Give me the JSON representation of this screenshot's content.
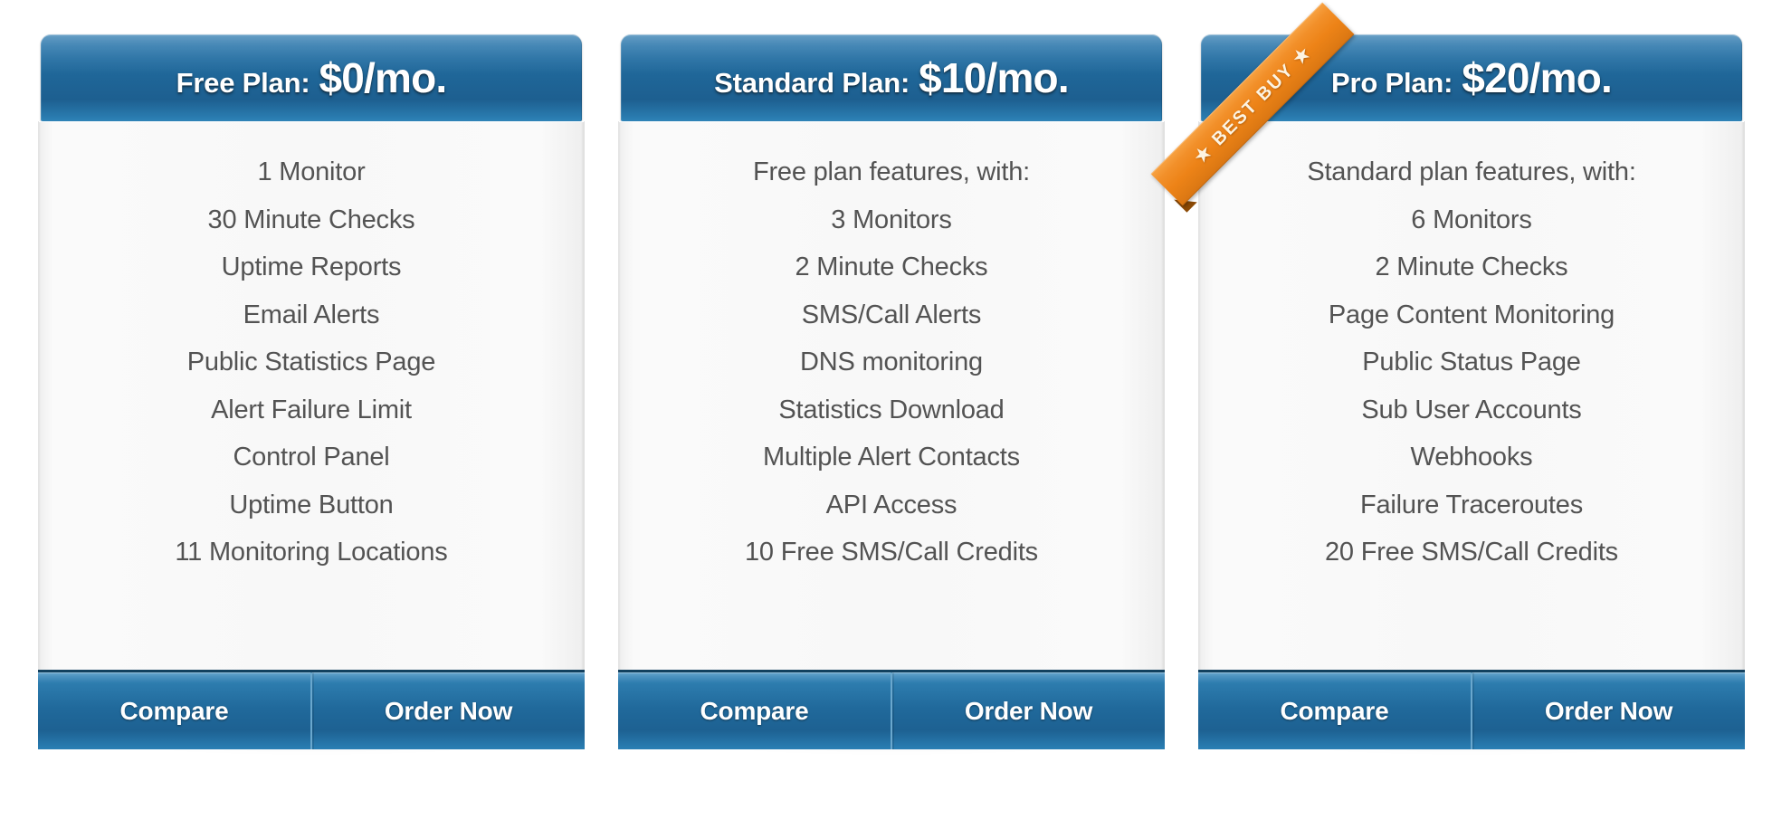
{
  "page": {
    "background_color": "#ffffff",
    "accent_blue": "#1f6698",
    "ribbon_orange": "#ed8317",
    "feature_text_color": "#535353"
  },
  "buttons": {
    "compare_label": "Compare",
    "order_label": "Order Now"
  },
  "ribbon": {
    "label": "★ BEST BUY ★",
    "icon": "ribbon-corner-icon"
  },
  "plans": [
    {
      "id": "free",
      "name": "Free Plan:",
      "price": "$0/mo.",
      "best_buy": false,
      "features": [
        "1 Monitor",
        "30 Minute Checks",
        "Uptime Reports",
        "Email Alerts",
        "Public Statistics Page",
        "Alert Failure Limit",
        "Control Panel",
        "Uptime Button",
        "11 Monitoring Locations"
      ]
    },
    {
      "id": "standard",
      "name": "Standard Plan:",
      "price": "$10/mo.",
      "best_buy": false,
      "features": [
        "Free plan features, with:",
        "3 Monitors",
        "2 Minute Checks",
        "SMS/Call Alerts",
        "DNS monitoring",
        "Statistics Download",
        "Multiple Alert Contacts",
        "API Access",
        "10 Free SMS/Call Credits"
      ]
    },
    {
      "id": "pro",
      "name": "Pro Plan:",
      "price": "$20/mo.",
      "best_buy": true,
      "features": [
        "Standard plan features, with:",
        "6 Monitors",
        "2 Minute Checks",
        "Page Content Monitoring",
        "Public Status Page",
        "Sub User Accounts",
        "Webhooks",
        "Failure Traceroutes",
        "20 Free SMS/Call Credits"
      ]
    }
  ]
}
